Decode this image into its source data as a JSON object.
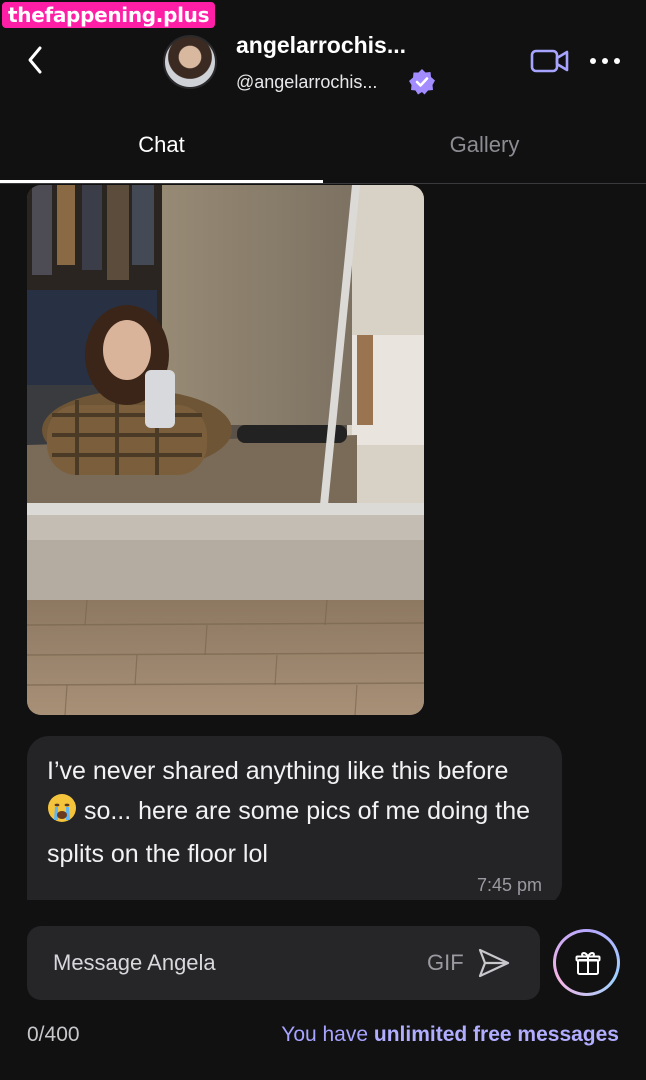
{
  "watermark": "thefappening.plus",
  "header": {
    "name": "angelarrochis...",
    "handle": "@angelarrochis...",
    "icons": [
      "back-chevron-icon",
      "verified-badge-icon",
      "video-call-icon",
      "more-dots-icon"
    ]
  },
  "tabs": [
    {
      "label": "Chat",
      "active": true
    },
    {
      "label": "Gallery",
      "active": false
    }
  ],
  "message": {
    "text_before_emoji": "I’ve never shared anything like this before",
    "emoji": "😭",
    "text_after_emoji": " so... here are some pics of me doing the splits on the floor lol",
    "time": "7:45 pm"
  },
  "composer": {
    "placeholder": "Message Angela",
    "gif_label": "GIF",
    "char_count": "0/400",
    "free_prefix": "You have ",
    "free_bold": "unlimited free messages"
  },
  "colors": {
    "background": "#111112",
    "bubble": "#242427",
    "accent": "#a7a4ff",
    "watermark": "#ff1fa6"
  }
}
